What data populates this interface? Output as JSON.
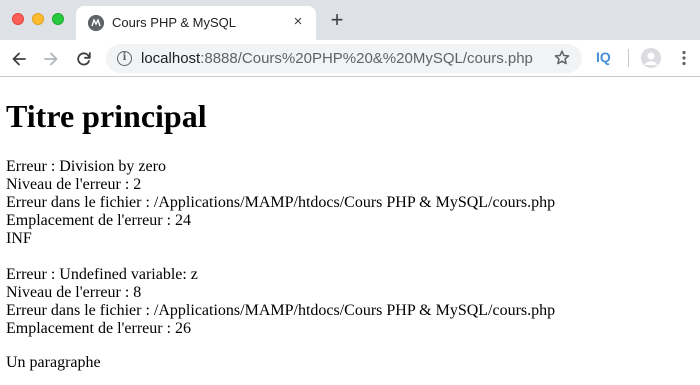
{
  "browser": {
    "tab_title": "Cours PHP & MySQL",
    "tab_close": "×",
    "new_tab": "+",
    "url_host": "localhost",
    "url_rest": ":8888/Cours%20PHP%20&%20MySQL/cours.php",
    "extension_label": "IQ",
    "icons": {
      "favicon": "php-favicon-icon",
      "back": "back-arrow-icon",
      "forward": "forward-arrow-icon",
      "reload": "reload-icon",
      "info": "info-icon",
      "star": "star-icon",
      "profile": "profile-icon",
      "menu": "kebab-menu-icon"
    },
    "colors": {
      "tabstrip_bg": "#dee1e6",
      "omnibox_bg": "#f1f3f4",
      "traffic_red": "#fe5f57",
      "traffic_yellow": "#febc2e",
      "traffic_green": "#28c840"
    }
  },
  "page": {
    "heading": "Titre principal",
    "error1": {
      "line1": "Erreur : Division by zero",
      "line2": "Niveau de l'erreur : 2",
      "line3": "Erreur dans le fichier : /Applications/MAMP/htdocs/Cours PHP & MySQL/cours.php",
      "line4": "Emplacement de l'erreur : 24"
    },
    "result": "INF",
    "error2": {
      "line1": "Erreur : Undefined variable: z",
      "line2": "Niveau de l'erreur : 8",
      "line3": "Erreur dans le fichier : /Applications/MAMP/htdocs/Cours PHP & MySQL/cours.php",
      "line4": "Emplacement de l'erreur : 26"
    },
    "paragraph": "Un paragraphe"
  }
}
